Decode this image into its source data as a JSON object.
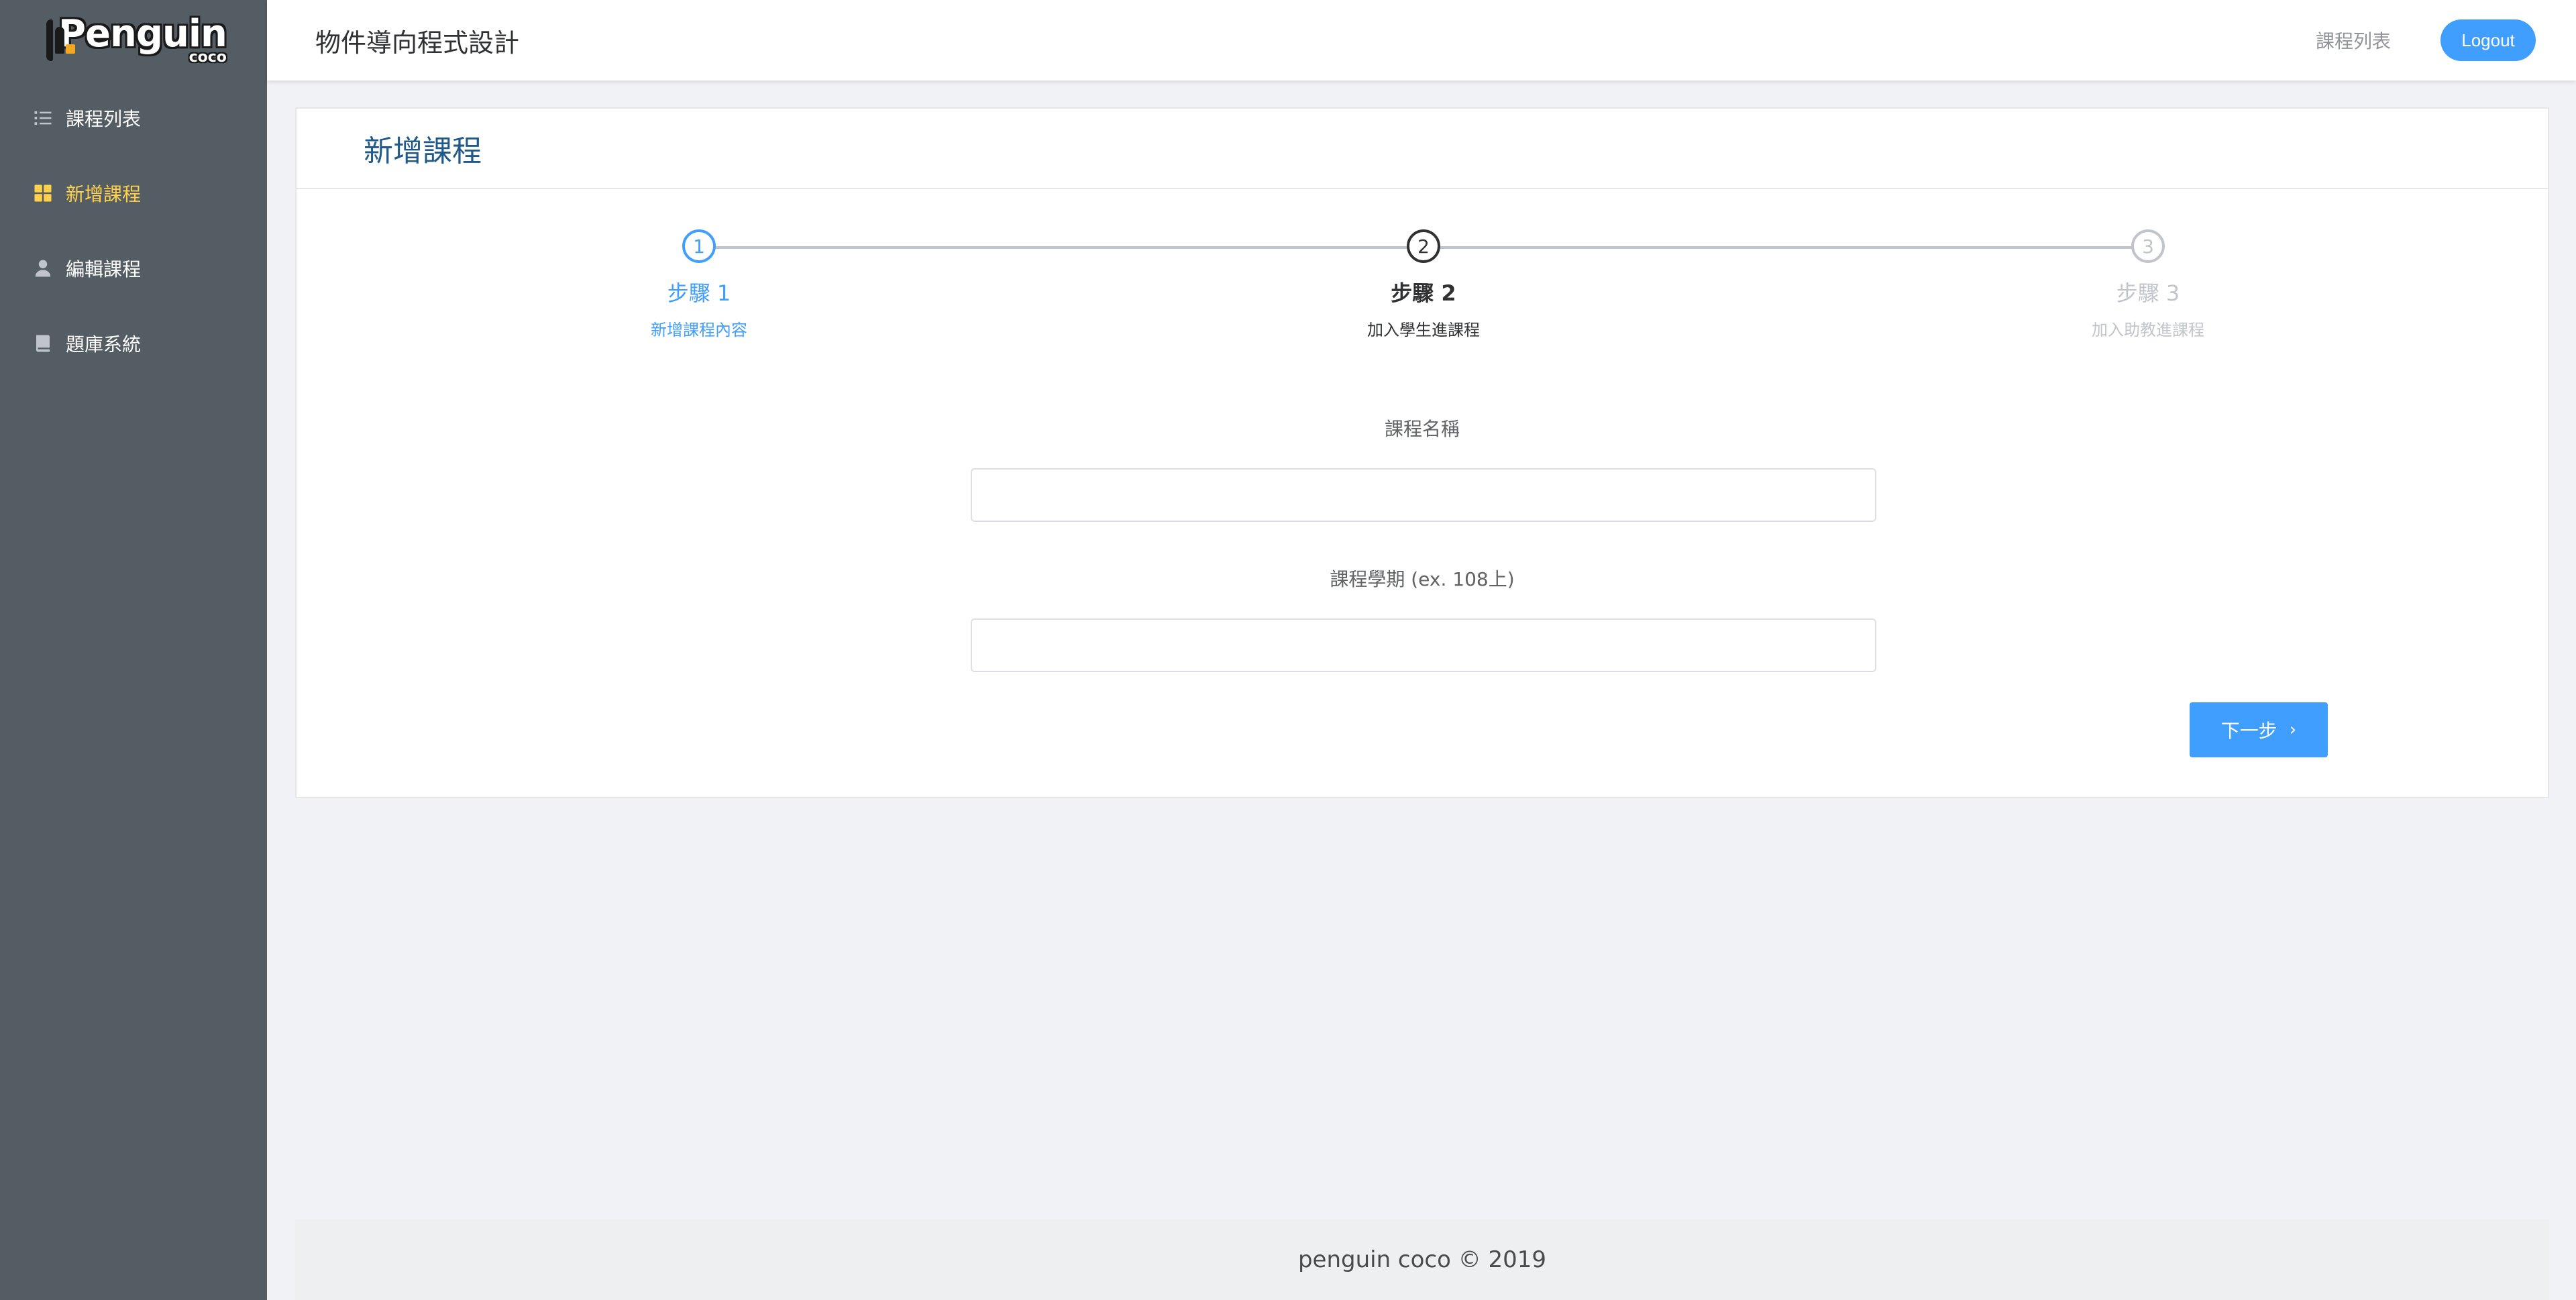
{
  "sidebar": {
    "logo": {
      "title": "Penguin",
      "sub": "coco"
    },
    "items": [
      {
        "label": "課程列表",
        "icon": "list-icon",
        "active": false
      },
      {
        "label": "新增課程",
        "icon": "grid-icon",
        "active": true
      },
      {
        "label": "編輯課程",
        "icon": "user-icon",
        "active": false
      },
      {
        "label": "題庫系統",
        "icon": "book-icon",
        "active": false
      }
    ],
    "active_color": "#ffd04b"
  },
  "header": {
    "title": "物件導向程式設計",
    "course_list_link": "課程列表",
    "logout_label": "Logout"
  },
  "card": {
    "title": "新增課程"
  },
  "steps": [
    {
      "number": "1",
      "title": "步驟 1",
      "description": "新增課程內容",
      "status": "finish"
    },
    {
      "number": "2",
      "title": "步驟 2",
      "description": "加入學生進課程",
      "status": "process"
    },
    {
      "number": "3",
      "title": "步驟 3",
      "description": "加入助教進課程",
      "status": "wait"
    }
  ],
  "form": {
    "course_name_label": "課程名稱",
    "course_name_value": "",
    "course_term_label": "課程學期 (ex. 108上)",
    "course_term_value": "",
    "next_button_label": "下一步"
  },
  "footer": {
    "text": "penguin coco © 2019"
  },
  "colors": {
    "primary": "#409eff",
    "sidebar_bg": "#545c64",
    "page_bg": "#f0f2f5",
    "card_title": "#1f5a8a"
  }
}
